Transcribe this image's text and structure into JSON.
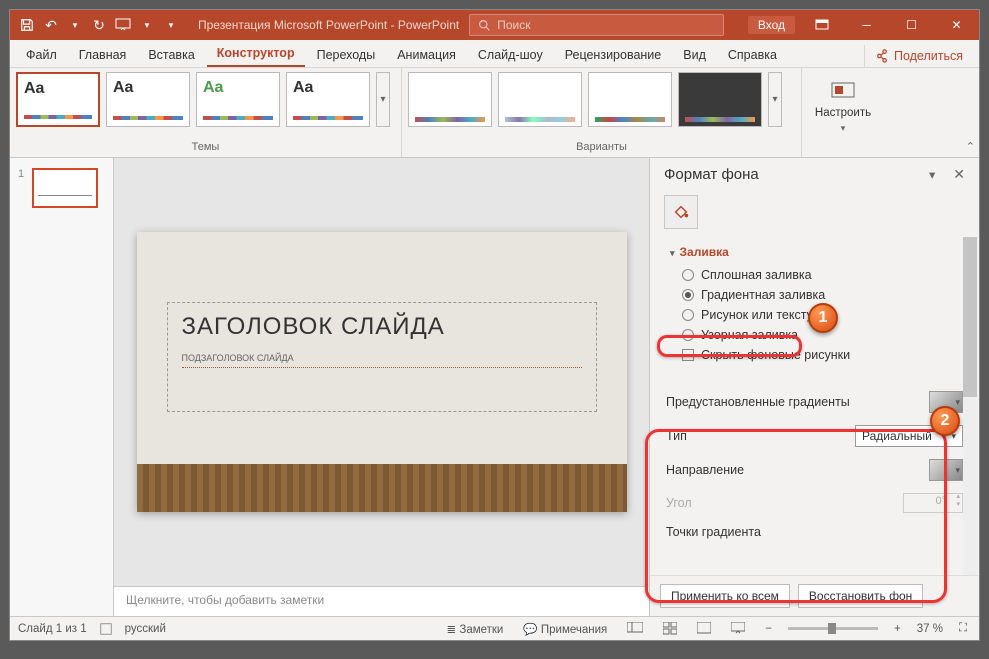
{
  "titlebar": {
    "title": "Презентация Microsoft PowerPoint  -  PowerPoint",
    "search_placeholder": "Поиск",
    "signin": "Вход"
  },
  "tabs": {
    "file": "Файл",
    "home": "Главная",
    "insert": "Вставка",
    "design": "Конструктор",
    "transitions": "Переходы",
    "animations": "Анимация",
    "slideshow": "Слайд-шоу",
    "review": "Рецензирование",
    "view": "Вид",
    "help": "Справка",
    "share": "Поделиться"
  },
  "ribbon": {
    "themes_label": "Темы",
    "variants_label": "Варианты",
    "customize": "Настроить"
  },
  "slide": {
    "title": "ЗАГОЛОВОК СЛАЙДА",
    "subtitle": "ПОДЗАГОЛОВОК СЛАЙДА"
  },
  "notes_hint": "Щелкните, чтобы добавить заметки",
  "pane": {
    "title": "Формат фона",
    "section_fill": "Заливка",
    "solid": "Сплошная заливка",
    "gradient": "Градиентная заливка",
    "picture": "Рисунок или текстура",
    "pattern": "Узорная заливка",
    "hide_bg": "Скрыть фоновые рисунки",
    "preset": "Предустановленные градиенты",
    "type": "Тип",
    "type_value": "Радиальный",
    "direction": "Направление",
    "angle": "Угол",
    "angle_value": "0°",
    "stops": "Точки градиента",
    "apply_all": "Применить ко всем",
    "reset": "Восстановить фон"
  },
  "status": {
    "slide_of": "Слайд 1 из 1",
    "lang": "русский",
    "notes": "Заметки",
    "comments": "Примечания",
    "zoom": "37 %"
  },
  "callouts": {
    "c1": "1",
    "c2": "2"
  }
}
